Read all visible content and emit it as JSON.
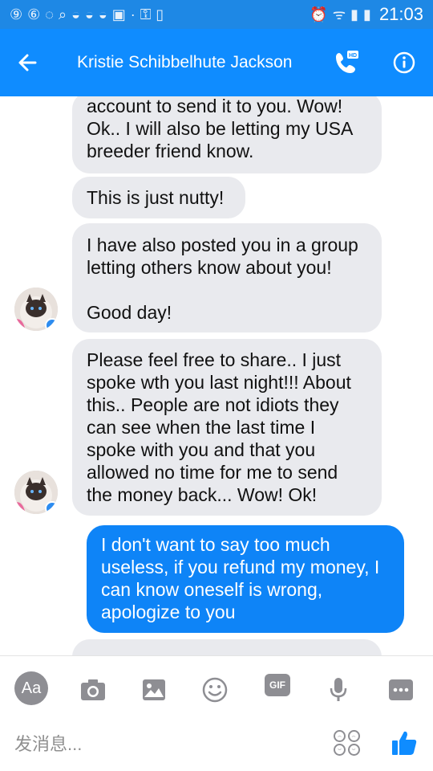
{
  "status_bar": {
    "time": "21:03",
    "left_icons": [
      "notification-9-icon",
      "app-icon",
      "loop-icon",
      "search-icon",
      "weibo-icon",
      "weibo-icon",
      "weibo-icon",
      "image-icon",
      "small-dot-icon",
      "key-icon",
      "screen-icon"
    ],
    "right_icons": [
      "alarm-icon",
      "wifi-icon",
      "signal-icon",
      "battery-icon"
    ]
  },
  "header": {
    "title": "Kristie Schibbelhute Jackson",
    "hd_label": "HD",
    "colors": {
      "bar": "#0f8cff",
      "status": "#1e88e5"
    }
  },
  "messages": [
    {
      "side": "received",
      "text": "account to send it to you. Wow!\nOk.. I will also be letting my USA\nbreeder friend know."
    },
    {
      "side": "received",
      "text": "This is just nutty!"
    },
    {
      "side": "received",
      "text": "I have also posted you in a group\nletting others know about you!\n\nGood day!"
    },
    {
      "side": "received",
      "text": "Please feel free to share.. I just\nspoke wth you last night!!! About\nthis.. People are not idiots they\ncan see when the last time I\nspoke with you and that you\nallowed no time for me to send\nthe money back... Wow! Ok!"
    },
    {
      "side": "sent",
      "text": "I don't want to say too much\nuseless, if you refund my money, I\ncan know oneself is wrong,\napologize to you"
    }
  ],
  "composer": {
    "aa_label": "Aa",
    "gif_label": "GIF",
    "placeholder": "发消息...",
    "tools": [
      "aa-button",
      "camera-icon",
      "gallery-icon",
      "emoji-icon",
      "gif-button",
      "microphone-icon",
      "more-icon"
    ]
  },
  "colors": {
    "received_bubble": "#e9eaee",
    "sent_bubble": "#0e84f7",
    "accent": "#0f8cff",
    "tool_gray": "#8e8e93"
  }
}
